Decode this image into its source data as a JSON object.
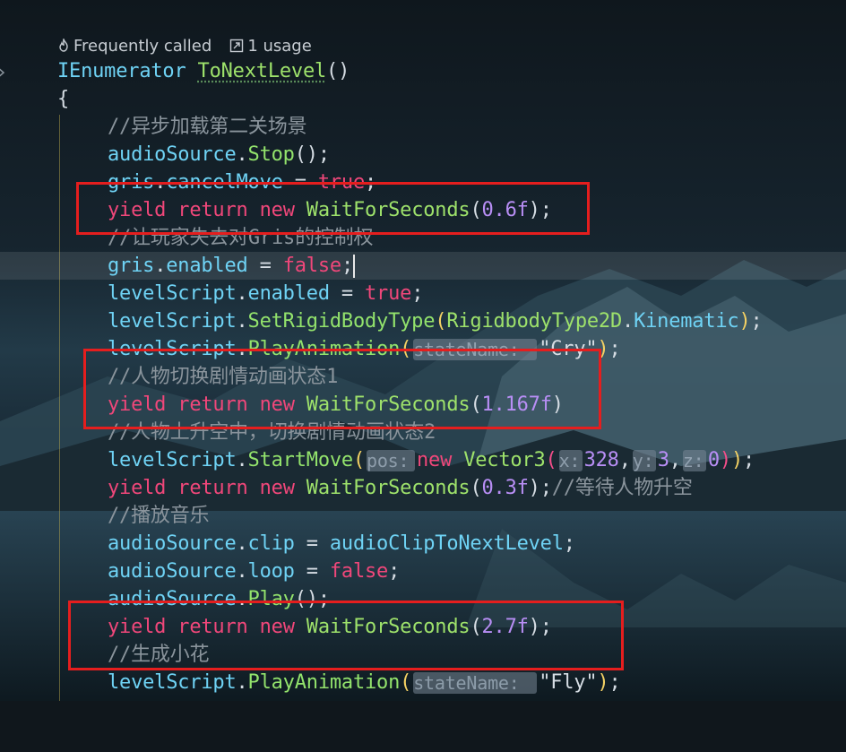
{
  "hints": {
    "frequently": "Frequently called",
    "usage": "1 usage"
  },
  "colors": {
    "keyword": "#f0477a",
    "type": "#9ee26b",
    "variable": "#6fd3f5",
    "comment": "#8a949c",
    "number": "#b88ef5",
    "highlight_box": "#e51e1e"
  },
  "code": {
    "sig_type": "IEnumerator",
    "sig_name": "ToNextLevel",
    "sig_parens": "()",
    "open_brace": "{",
    "c1": "//异步加载第二关场景",
    "audioSource": "audioSource",
    "gris": "gris",
    "levelScript": "levelScript",
    "dot": ".",
    "stop": "Stop",
    "call_end": "();",
    "cancelMove": "cancelMove",
    "eq": " = ",
    "true_kw": "true",
    "false_kw": "false",
    "semi": ";",
    "yield": "yield",
    "return": "return",
    "new": "new",
    "waitFor": "WaitForSeconds",
    "n06": "0.6f",
    "n1167": "1.167f",
    "n03": "0.3f",
    "n27": "2.7f",
    "c2": "//让玩家失去对Gris的控制权",
    "enabled": "enabled",
    "setRigid": "SetRigidBodyType",
    "rbType": "RigidbodyType2D",
    "kinematic": "Kinematic",
    "playAnim": "PlayAnimation",
    "hint_stateName": "stateName:",
    "cry": "\"Cry\"",
    "c3": "//人物切换剧情动画状态1",
    "c4": "//人物上升空中，切换剧情动画状态2",
    "startMove": "StartMove",
    "hint_pos": "pos:",
    "vector3": "Vector3",
    "hint_x": "x:",
    "hint_y": "y:",
    "hint_z": "z:",
    "v328": "328",
    "v3": "3",
    "v0": "0",
    "c_wait": "//等待人物升空",
    "c5": "//播放音乐",
    "clip": "clip",
    "audioClip": "audioClipToNextLevel",
    "loop": "loop",
    "play": "Play",
    "c6": "//生成小花",
    "fly": "\"Fly\""
  }
}
